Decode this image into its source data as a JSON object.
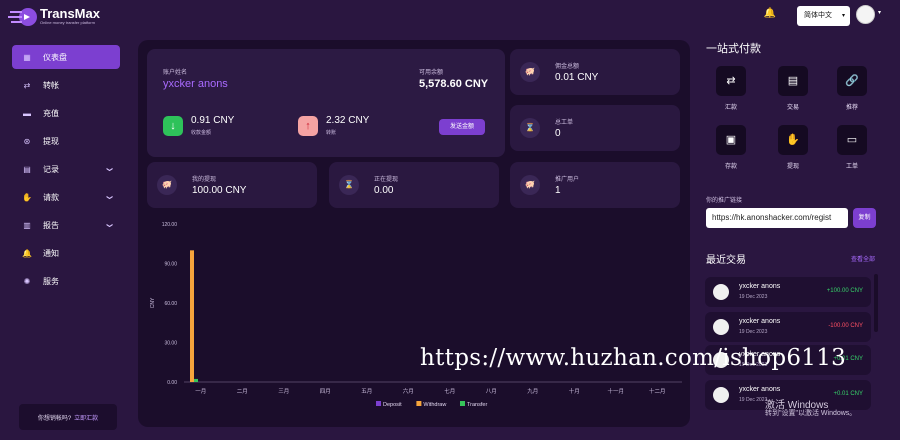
{
  "header": {
    "brand": "TransMax",
    "tagline": "Online money transfer platform",
    "language": "简体中文",
    "language_caret": "▾",
    "avatar_caret": "▾"
  },
  "sidebar": {
    "items": [
      {
        "label": "仪表盘",
        "icon": "grid-icon",
        "glyph": "▦",
        "active": true,
        "chevron": false
      },
      {
        "label": "转帐",
        "icon": "swap-icon",
        "glyph": "⇄",
        "chevron": false
      },
      {
        "label": "充值",
        "icon": "card-icon",
        "glyph": "▬",
        "chevron": false
      },
      {
        "label": "提现",
        "icon": "withdraw-icon",
        "glyph": "⊛",
        "chevron": false
      },
      {
        "label": "记录",
        "icon": "document-icon",
        "glyph": "▤",
        "chevron": true
      },
      {
        "label": "请款",
        "icon": "hand-money-icon",
        "glyph": "✋",
        "chevron": true
      },
      {
        "label": "报告",
        "icon": "bar-chart-icon",
        "glyph": "▥",
        "chevron": true
      },
      {
        "label": "通知",
        "icon": "bell-icon",
        "glyph": "🔔",
        "chevron": false
      },
      {
        "label": "服务",
        "icon": "globe-icon",
        "glyph": "✺",
        "chevron": false
      }
    ],
    "account_q": "你想销帐吗?",
    "account_link": "立即汇款"
  },
  "balance_card": {
    "name_label": "账户姓名",
    "name": "yxcker anons",
    "avail_label": "可用余额",
    "avail": "5,578.60 CNY",
    "received_value": "0.91 CNY",
    "received_label": "收款金额",
    "transfer_value": "2.32 CNY",
    "transfer_label": "转账",
    "send_btn": "发送金额"
  },
  "stats": [
    {
      "label": "佣金总额",
      "value": "0.01 CNY",
      "icon": "piggy-bank-icon",
      "glyph": "🐖"
    },
    {
      "label": "总工单",
      "value": "0",
      "icon": "hourglass-icon",
      "glyph": "⌛"
    },
    {
      "label": "我的提现",
      "value": "100.00 CNY",
      "icon": "piggy-bank-icon",
      "glyph": "🐖"
    },
    {
      "label": "正在提现",
      "value": "0.00",
      "icon": "hourglass-icon",
      "glyph": "⌛"
    },
    {
      "label": "推广用户",
      "value": "1",
      "icon": "piggy-bank-icon",
      "glyph": "🐖"
    }
  ],
  "chart_data": {
    "type": "bar",
    "ylabel": "CNY",
    "ylim": [
      0,
      120
    ],
    "yticks": [
      "0.00",
      "30.00",
      "60.00",
      "90.00",
      "120.00"
    ],
    "categories": [
      "一月",
      "二月",
      "三月",
      "四月",
      "五月",
      "六月",
      "七月",
      "八月",
      "九月",
      "十月",
      "十一月",
      "十二月"
    ],
    "series": [
      {
        "name": "Deposit",
        "color": "#7c3fd0",
        "values": [
          0,
          0,
          0,
          0,
          0,
          0,
          0,
          0,
          0,
          0,
          0,
          0
        ]
      },
      {
        "name": "Withdraw",
        "color": "#f6a43c",
        "values": [
          100,
          0,
          0,
          0,
          0,
          0,
          0,
          0,
          0,
          0,
          0,
          0
        ]
      },
      {
        "name": "Transfer",
        "color": "#37c45a",
        "values": [
          2.32,
          0,
          0,
          0,
          0,
          0,
          0,
          0,
          0,
          0,
          0,
          0
        ]
      }
    ]
  },
  "quick": {
    "title": "一站式付款",
    "items": [
      {
        "label": "汇款",
        "glyph": "⇄",
        "icon": "exchange-icon"
      },
      {
        "label": "交易",
        "glyph": "▤",
        "icon": "document-icon"
      },
      {
        "label": "推荐",
        "glyph": "🔗",
        "icon": "link-icon"
      },
      {
        "label": "存款",
        "glyph": "▣",
        "icon": "wallet-icon"
      },
      {
        "label": "提现",
        "glyph": "✋",
        "icon": "hand-money-icon"
      },
      {
        "label": "工单",
        "glyph": "▭",
        "icon": "ticket-icon"
      }
    ]
  },
  "referral": {
    "label": "你的推广链接",
    "url": "https://hk.anonshacker.com/regist",
    "copy": "复制"
  },
  "recent": {
    "title": "最近交易",
    "view_all": "查看全部",
    "items": [
      {
        "name": "yxcker anons",
        "date": "19 Dec 2023",
        "amount": "+100.00 CNY",
        "positive": true
      },
      {
        "name": "yxcker anons",
        "date": "19 Dec 2023",
        "amount": "-100.00 CNY",
        "positive": false
      },
      {
        "name": "yxcker anons",
        "date": "19 Dec 2023",
        "amount": "+0.01 CNY",
        "positive": true
      },
      {
        "name": "yxcker anons",
        "date": "19 Dec 2023",
        "amount": "+0.01 CNY",
        "positive": true
      }
    ]
  },
  "watermark": "https://www.huzhan.com/ishop6113",
  "windows": {
    "line1": "激活 Windows",
    "line2": "转到\"设置\"以激活 Windows。"
  }
}
